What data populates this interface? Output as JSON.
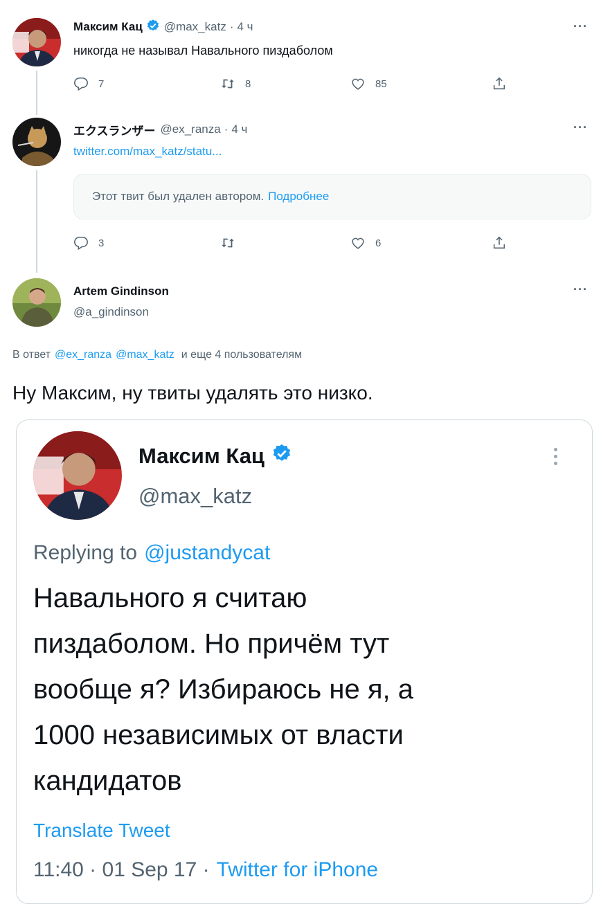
{
  "tweets": [
    {
      "name": "Максим Кац",
      "handle": "@max_katz",
      "time": "4 ч",
      "text": "никогда не называл Навального пиздаболом",
      "replies": "7",
      "retweets": "8",
      "likes": "85"
    },
    {
      "name": "エクスランザー",
      "handle": "@ex_ranza",
      "time": "4 ч",
      "link": "twitter.com/max_katz/statu...",
      "deleted_text": "Этот твит был удален автором.",
      "deleted_link": "Подробнее",
      "replies": "3",
      "likes": "6"
    }
  ],
  "reply": {
    "name": "Artem Gindinson",
    "handle": "@a_gindinson",
    "reply_prefix": "В ответ",
    "mention1": "@ex_ranza",
    "mention2": "@max_katz",
    "reply_suffix": "и еще 4 пользователям",
    "text": "Ну Максим, ну твиты удалять это низко."
  },
  "quoted": {
    "name": "Максим Кац",
    "handle": "@max_katz",
    "replying_prefix": "Replying to",
    "replying_to": "@justandycat",
    "text_lines": [
      "Навального я считаю",
      "пиздаболом. Но причём тут",
      "вообще я? Избираюсь не я, а",
      "1000 независимых от власти",
      "кандидатов"
    ],
    "translate": "Translate Tweet",
    "meta_time": "11:40 · 01 Sep 17 ·",
    "meta_source": "Twitter for iPhone"
  },
  "icons": {
    "reply": "reply-icon",
    "retweet": "retweet-icon",
    "like": "heart-icon",
    "share": "share-icon",
    "verified": "verified-badge-icon",
    "more": "more-dots-icon"
  },
  "colors": {
    "accent": "#1d9bf0",
    "text": "#0f1419",
    "muted": "#536471",
    "border": "#cfd9de"
  }
}
